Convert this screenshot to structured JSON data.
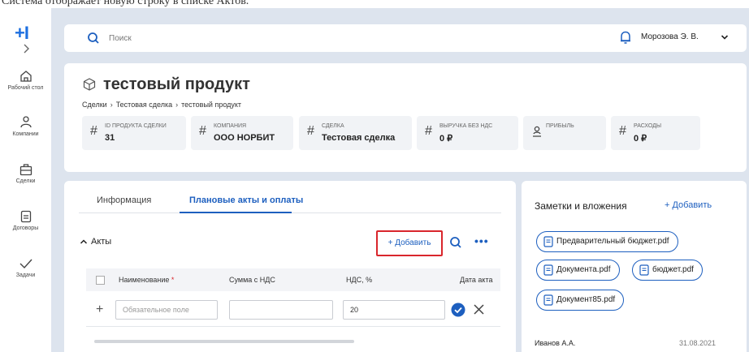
{
  "caption": "Система отображает новую строку в списке Актов.",
  "sidebar": {
    "logo": "+I",
    "items": [
      {
        "label": "Рабочий стол",
        "icon": "home-icon"
      },
      {
        "label": "Компании",
        "icon": "people-icon"
      },
      {
        "label": "Сделки",
        "icon": "briefcase-icon"
      },
      {
        "label": "Договоры",
        "icon": "document-icon"
      },
      {
        "label": "Задачи",
        "icon": "checkmark-icon"
      }
    ]
  },
  "header": {
    "search_placeholder": "Поиск",
    "user": "Морозова Э. В."
  },
  "product": {
    "title": "тестовый продукт",
    "breadcrumbs": [
      "Сделки",
      "Тестовая сделка",
      "тестовый продукт"
    ],
    "stats": [
      {
        "label": "ID продукта сделки",
        "value": "31"
      },
      {
        "label": "Компания",
        "value": "ООО НОРБИТ"
      },
      {
        "label": "Сделка",
        "value": "Тестовая сделка"
      },
      {
        "label": "Выручка без НДС",
        "value": "0 ₽"
      },
      {
        "label": "Прибыль",
        "value": ""
      },
      {
        "label": "Расходы",
        "value": "0 ₽"
      }
    ]
  },
  "tabs": {
    "info": "Информация",
    "plan": "Плановые акты и оплаты"
  },
  "acts": {
    "title": "Акты",
    "add_label": "+ Добавить",
    "columns": {
      "name": "Наименование",
      "required_mark": "*",
      "sum": "Сумма с НДС",
      "vat": "НДС, %",
      "date": "Дата акта"
    },
    "new_row": {
      "name_placeholder": "Обязательное поле",
      "sum_value": "",
      "vat_value": "20"
    }
  },
  "notes": {
    "title": "Заметки и вложения",
    "add_label": "+ Добавить",
    "files": [
      "Предварительный бюджет.pdf",
      "Документа.pdf",
      "бюджет.pdf",
      "Документ85.pdf"
    ],
    "author": "Иванов А.А.",
    "date": "31.08.2021"
  },
  "colors": {
    "accent": "#1d5fbf",
    "highlight": "#d9262c",
    "background": "#dde4ee"
  }
}
